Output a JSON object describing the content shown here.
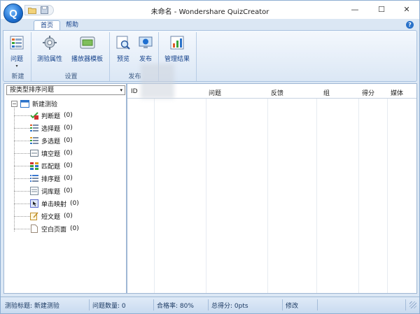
{
  "window": {
    "title": "未命名 - Wondershare QuizCreator",
    "logo_letter": "Q",
    "min_glyph": "—",
    "max_glyph": "☐",
    "close_glyph": "✕"
  },
  "ribbon": {
    "tabs": [
      {
        "label": "首页",
        "active": true
      },
      {
        "label": "帮助",
        "active": false
      }
    ],
    "help_glyph": "?",
    "groups": [
      {
        "label": "新建",
        "buttons": [
          {
            "label": "问题",
            "icon": "question-icon",
            "has_dropdown": true
          }
        ]
      },
      {
        "label": "设置",
        "buttons": [
          {
            "label": "测验属性",
            "icon": "gear-icon"
          },
          {
            "label": "播放器模板",
            "icon": "template-icon"
          }
        ]
      },
      {
        "label": "发布",
        "buttons": [
          {
            "label": "预览",
            "icon": "preview-icon"
          },
          {
            "label": "发布",
            "icon": "publish-icon"
          }
        ]
      },
      {
        "label": "",
        "buttons": [
          {
            "label": "管理结果",
            "icon": "manage-results-icon"
          }
        ]
      }
    ],
    "dropdown_caret": "▾"
  },
  "left_panel": {
    "sort_select": {
      "value": "按类型排序问题",
      "arrow": "▾"
    },
    "tree": {
      "collapse_glyph": "−",
      "root": {
        "label": "新建测验",
        "icon": "quiz-icon"
      },
      "items": [
        {
          "label": "判断题",
          "count": "(0)",
          "icon": "true-false-icon",
          "color": "#3aa43a"
        },
        {
          "label": "选择题",
          "count": "(0)",
          "icon": "multiple-choice-icon",
          "color": "#e05a2a"
        },
        {
          "label": "多选题",
          "count": "(0)",
          "icon": "multiple-response-icon",
          "color": "#e0a020"
        },
        {
          "label": "填空题",
          "count": "(0)",
          "icon": "fill-blank-icon",
          "color": "#6a7a8a"
        },
        {
          "label": "匹配题",
          "count": "(0)",
          "icon": "matching-icon",
          "color": "#d03030"
        },
        {
          "label": "排序题",
          "count": "(0)",
          "icon": "sequence-icon",
          "color": "#3a78d0"
        },
        {
          "label": "词库题",
          "count": "(0)",
          "icon": "word-bank-icon",
          "color": "#7a8a9a"
        },
        {
          "label": "单击映射",
          "count": "(0)",
          "icon": "click-map-icon",
          "color": "#5a6ad0"
        },
        {
          "label": "短文题",
          "count": "(0)",
          "icon": "short-essay-icon",
          "color": "#c0902a"
        },
        {
          "label": "空白页面",
          "count": "(0)",
          "icon": "blank-page-icon",
          "color": "#9a8a7a"
        }
      ]
    }
  },
  "grid": {
    "columns": [
      "ID",
      "问题",
      "反馈",
      "组",
      "得分",
      "媒体"
    ]
  },
  "statusbar": {
    "quiz_title": "测验标题: 新建测验",
    "question_count": "问题数量: 0",
    "pass_rate": "合格率: 80%",
    "total_score": "总得分: 0pts",
    "modified": "修改"
  }
}
